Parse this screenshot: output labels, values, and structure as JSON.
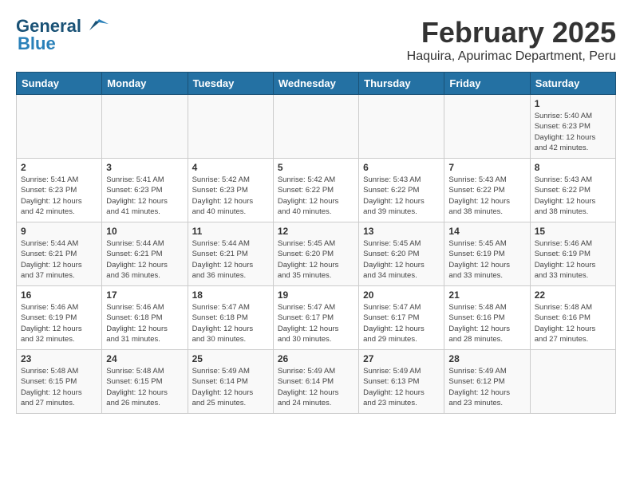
{
  "header": {
    "logo_general": "General",
    "logo_blue": "Blue",
    "month_year": "February 2025",
    "location": "Haquira, Apurimac Department, Peru"
  },
  "weekdays": [
    "Sunday",
    "Monday",
    "Tuesday",
    "Wednesday",
    "Thursday",
    "Friday",
    "Saturday"
  ],
  "weeks": [
    [
      {
        "day": "",
        "info": ""
      },
      {
        "day": "",
        "info": ""
      },
      {
        "day": "",
        "info": ""
      },
      {
        "day": "",
        "info": ""
      },
      {
        "day": "",
        "info": ""
      },
      {
        "day": "",
        "info": ""
      },
      {
        "day": "1",
        "info": "Sunrise: 5:40 AM\nSunset: 6:23 PM\nDaylight: 12 hours\nand 42 minutes."
      }
    ],
    [
      {
        "day": "2",
        "info": "Sunrise: 5:41 AM\nSunset: 6:23 PM\nDaylight: 12 hours\nand 42 minutes."
      },
      {
        "day": "3",
        "info": "Sunrise: 5:41 AM\nSunset: 6:23 PM\nDaylight: 12 hours\nand 41 minutes."
      },
      {
        "day": "4",
        "info": "Sunrise: 5:42 AM\nSunset: 6:23 PM\nDaylight: 12 hours\nand 40 minutes."
      },
      {
        "day": "5",
        "info": "Sunrise: 5:42 AM\nSunset: 6:22 PM\nDaylight: 12 hours\nand 40 minutes."
      },
      {
        "day": "6",
        "info": "Sunrise: 5:43 AM\nSunset: 6:22 PM\nDaylight: 12 hours\nand 39 minutes."
      },
      {
        "day": "7",
        "info": "Sunrise: 5:43 AM\nSunset: 6:22 PM\nDaylight: 12 hours\nand 38 minutes."
      },
      {
        "day": "8",
        "info": "Sunrise: 5:43 AM\nSunset: 6:22 PM\nDaylight: 12 hours\nand 38 minutes."
      }
    ],
    [
      {
        "day": "9",
        "info": "Sunrise: 5:44 AM\nSunset: 6:21 PM\nDaylight: 12 hours\nand 37 minutes."
      },
      {
        "day": "10",
        "info": "Sunrise: 5:44 AM\nSunset: 6:21 PM\nDaylight: 12 hours\nand 36 minutes."
      },
      {
        "day": "11",
        "info": "Sunrise: 5:44 AM\nSunset: 6:21 PM\nDaylight: 12 hours\nand 36 minutes."
      },
      {
        "day": "12",
        "info": "Sunrise: 5:45 AM\nSunset: 6:20 PM\nDaylight: 12 hours\nand 35 minutes."
      },
      {
        "day": "13",
        "info": "Sunrise: 5:45 AM\nSunset: 6:20 PM\nDaylight: 12 hours\nand 34 minutes."
      },
      {
        "day": "14",
        "info": "Sunrise: 5:45 AM\nSunset: 6:19 PM\nDaylight: 12 hours\nand 33 minutes."
      },
      {
        "day": "15",
        "info": "Sunrise: 5:46 AM\nSunset: 6:19 PM\nDaylight: 12 hours\nand 33 minutes."
      }
    ],
    [
      {
        "day": "16",
        "info": "Sunrise: 5:46 AM\nSunset: 6:19 PM\nDaylight: 12 hours\nand 32 minutes."
      },
      {
        "day": "17",
        "info": "Sunrise: 5:46 AM\nSunset: 6:18 PM\nDaylight: 12 hours\nand 31 minutes."
      },
      {
        "day": "18",
        "info": "Sunrise: 5:47 AM\nSunset: 6:18 PM\nDaylight: 12 hours\nand 30 minutes."
      },
      {
        "day": "19",
        "info": "Sunrise: 5:47 AM\nSunset: 6:17 PM\nDaylight: 12 hours\nand 30 minutes."
      },
      {
        "day": "20",
        "info": "Sunrise: 5:47 AM\nSunset: 6:17 PM\nDaylight: 12 hours\nand 29 minutes."
      },
      {
        "day": "21",
        "info": "Sunrise: 5:48 AM\nSunset: 6:16 PM\nDaylight: 12 hours\nand 28 minutes."
      },
      {
        "day": "22",
        "info": "Sunrise: 5:48 AM\nSunset: 6:16 PM\nDaylight: 12 hours\nand 27 minutes."
      }
    ],
    [
      {
        "day": "23",
        "info": "Sunrise: 5:48 AM\nSunset: 6:15 PM\nDaylight: 12 hours\nand 27 minutes."
      },
      {
        "day": "24",
        "info": "Sunrise: 5:48 AM\nSunset: 6:15 PM\nDaylight: 12 hours\nand 26 minutes."
      },
      {
        "day": "25",
        "info": "Sunrise: 5:49 AM\nSunset: 6:14 PM\nDaylight: 12 hours\nand 25 minutes."
      },
      {
        "day": "26",
        "info": "Sunrise: 5:49 AM\nSunset: 6:14 PM\nDaylight: 12 hours\nand 24 minutes."
      },
      {
        "day": "27",
        "info": "Sunrise: 5:49 AM\nSunset: 6:13 PM\nDaylight: 12 hours\nand 23 minutes."
      },
      {
        "day": "28",
        "info": "Sunrise: 5:49 AM\nSunset: 6:12 PM\nDaylight: 12 hours\nand 23 minutes."
      },
      {
        "day": "",
        "info": ""
      }
    ]
  ]
}
